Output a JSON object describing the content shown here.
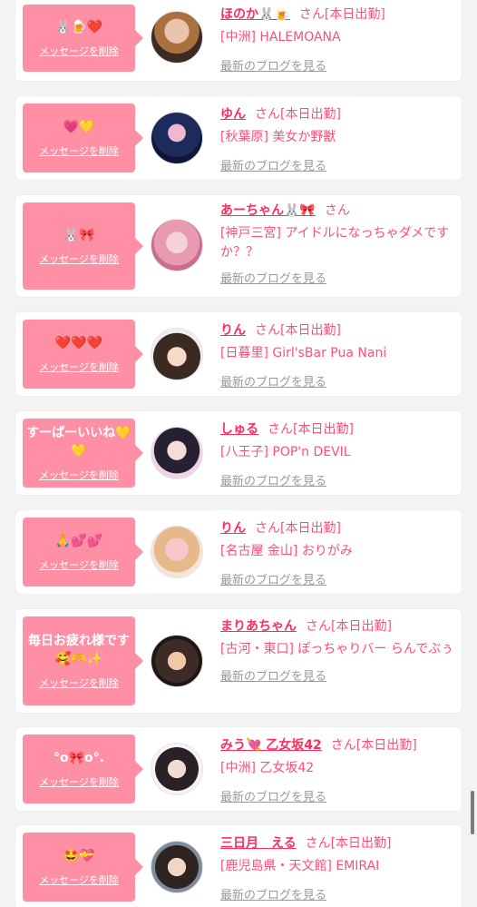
{
  "delete_label": "メッセージを削除",
  "blog_label": "最新のブログを見る",
  "san_label": "さん",
  "accent_color": "#ff8fa4",
  "text_color": "#ff4f75",
  "items": [
    {
      "msg": "🐰🍺❤️",
      "name": "ほのか🐰🍺",
      "status": "[本日出勤]",
      "shop": "[中洲] HALEMOANA"
    },
    {
      "msg": "💗💛",
      "name": "ゆん",
      "status": "[本日出勤]",
      "shop": "[秋葉原] 美女か野獣"
    },
    {
      "msg": "🐰🎀",
      "name": "あーちゃん🐰🎀",
      "status": "",
      "shop": "[神戸三宮] アイドルになっちゃダメですか？？"
    },
    {
      "msg": "❤️❤️❤️",
      "name": "りん",
      "status": "[本日出勤]",
      "shop": "[日暮里] Girl'sBar Pua Nani"
    },
    {
      "msg": "すーぱーいいね💛💛",
      "name": "しゅる",
      "status": "[本日出勤]",
      "shop": "[八王子] POP'n DEVIL"
    },
    {
      "msg": "🙏💕💕",
      "name": "りん",
      "status": "[本日出勤]",
      "shop": "[名古屋 金山] おりがみ"
    },
    {
      "msg": "毎日お疲れ様です🥰🫶✨",
      "name": "まりあちゃん",
      "status": "[本日出勤]",
      "shop": "[古河・東口] ぽっちゃりバー らんでぶぅ"
    },
    {
      "msg": "°o🎀o°.",
      "name": "みう💘 乙女坂42",
      "status": "[本日出勤]",
      "shop": "[中洲] 乙女坂42"
    },
    {
      "msg": "🤩💝",
      "name": "三日月　える",
      "status": "[本日出勤]",
      "shop": "[鹿児島県・天文館] EMIRAI"
    }
  ]
}
